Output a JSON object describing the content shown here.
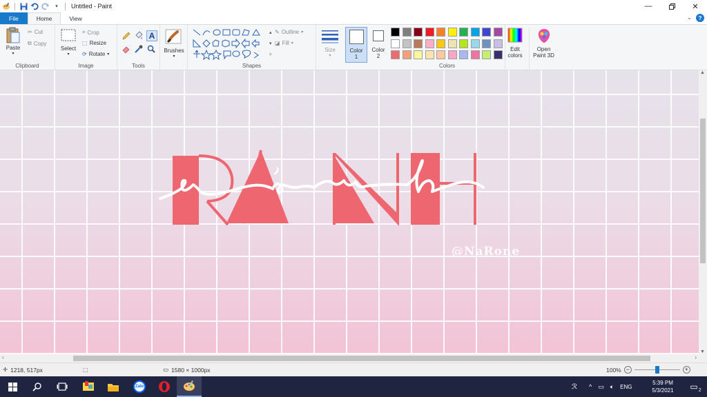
{
  "window": {
    "title": "Untitled - Paint"
  },
  "tabs": [
    {
      "label": "File"
    },
    {
      "label": "Home"
    },
    {
      "label": "View"
    }
  ],
  "ribbon": {
    "clipboard": {
      "paste": "Paste",
      "cut": "Cut",
      "copy": "Copy",
      "group": "Clipboard"
    },
    "image": {
      "select": "Select",
      "crop": "Crop",
      "resize": "Resize",
      "rotate": "Rotate",
      "group": "Image"
    },
    "tools": {
      "group": "Tools"
    },
    "brushes": {
      "label": "Brushes"
    },
    "shapes": {
      "outline": "Outline",
      "fill": "Fill",
      "group": "Shapes"
    },
    "size": {
      "label": "Size"
    },
    "color1": {
      "label": "Color",
      "num": "1",
      "value": "#ffffff"
    },
    "color2": {
      "label": "Color",
      "num": "2",
      "value": "#ffffff"
    },
    "colors": {
      "group": "Colors",
      "row1": [
        "#000000",
        "#7f7f7f",
        "#880015",
        "#ed1c24",
        "#ff7f27",
        "#fff200",
        "#22b14c",
        "#00a2e8",
        "#3f48cc",
        "#a349a4"
      ],
      "row2": [
        "#ffffff",
        "#c3c3c3",
        "#b97a57",
        "#ffaec9",
        "#ffc90e",
        "#efe4b0",
        "#b5e61d",
        "#99d9ea",
        "#7092be",
        "#c8bfe7"
      ],
      "row3": [
        "#ef6a6e",
        "#f2a07a",
        "#fbf79a",
        "#fce3b0",
        "#fbc8a0",
        "#f7a6c6",
        "#a7b8f2",
        "#f471a4",
        "#c6ee72",
        "#3c2d6e"
      ],
      "edit_label1": "Edit",
      "edit_label2": "colors"
    },
    "paint3d": {
      "label1": "Open",
      "label2": "Paint 3D"
    }
  },
  "canvas": {
    "word": "RANH",
    "script": "rảnh",
    "watermark": "@NaRone",
    "accent": "#ee6770"
  },
  "statusbar": {
    "cursor": "1218, 517px",
    "size": "1580 × 1000px",
    "zoom": "100%",
    "zoom_level": 1.0
  },
  "taskbar": {
    "language": "ENG",
    "time": "5:39 PM",
    "date": "5/3/2021",
    "notifications": "2",
    "apps": [
      {
        "name": "start"
      },
      {
        "name": "search"
      },
      {
        "name": "task-view"
      },
      {
        "name": "sticky-app"
      },
      {
        "name": "file-explorer"
      },
      {
        "name": "zalo",
        "label": "Zalo"
      },
      {
        "name": "opera"
      },
      {
        "name": "paint"
      }
    ]
  }
}
